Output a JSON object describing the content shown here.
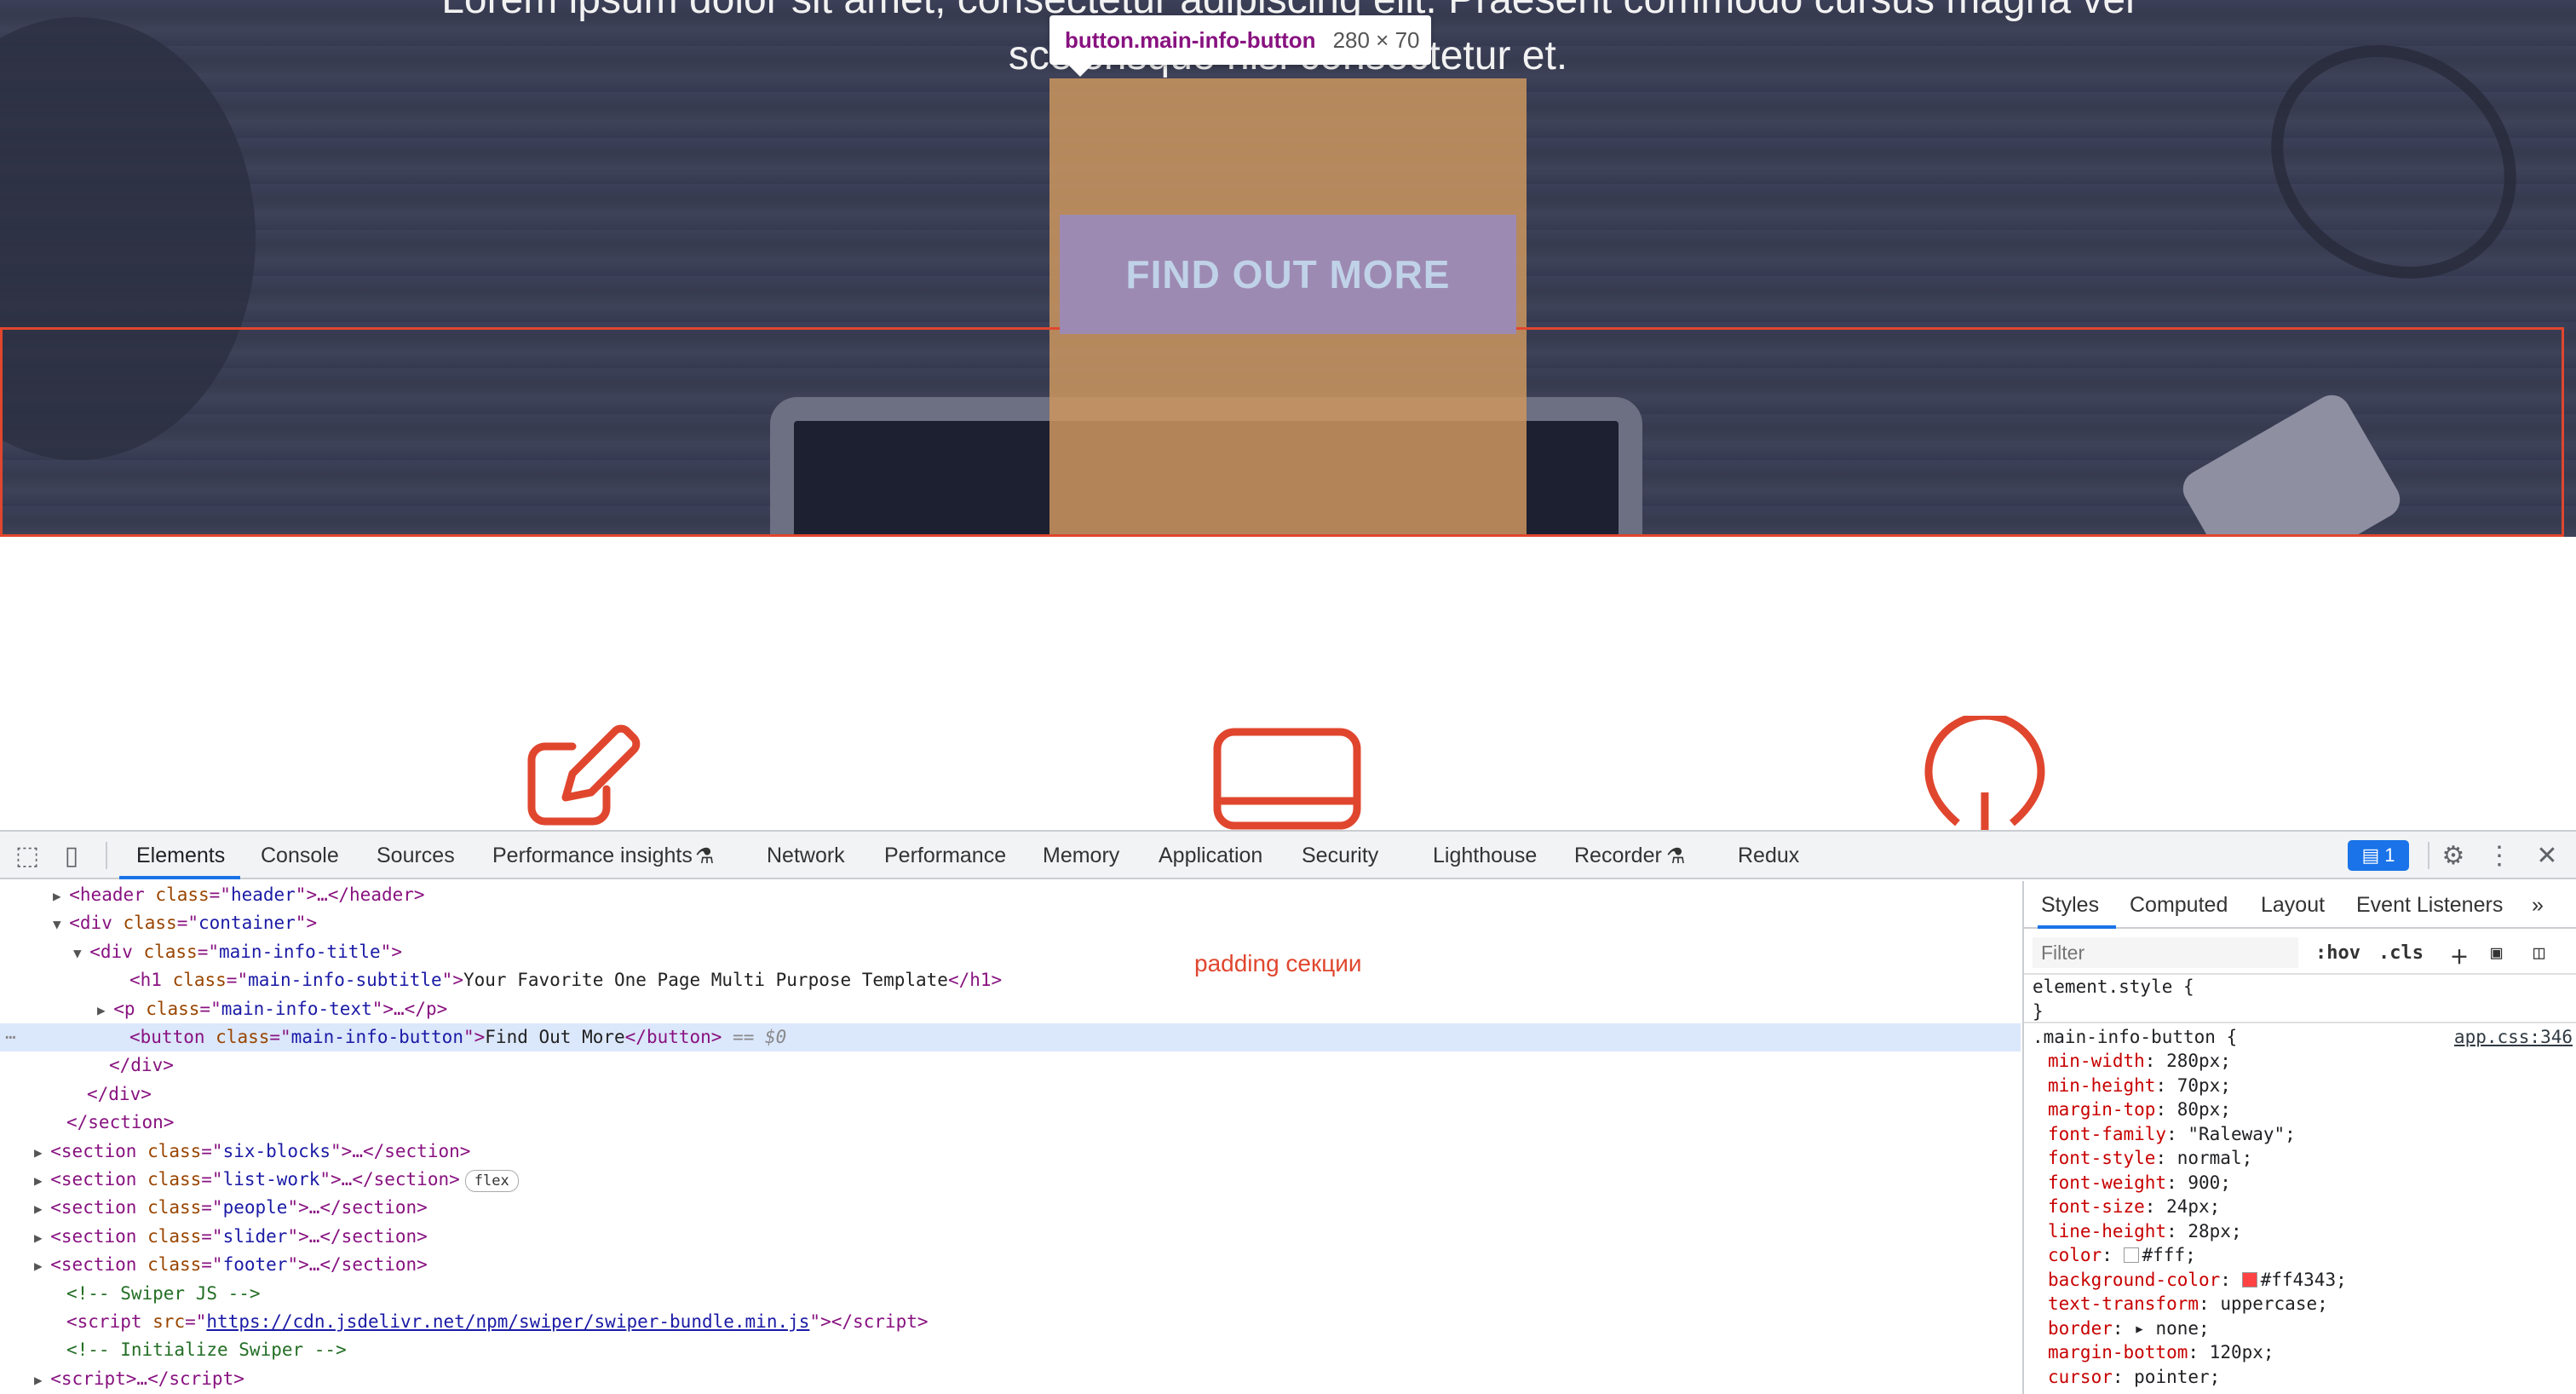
{
  "page": {
    "hero_line1": "Lorem ipsum dolor sit amet, consectetur adipiscing elit. Praesent commodo cursus magna vel",
    "hero_line2": "scelerisque nisl consectetur et.",
    "button_label": "FIND OUT MORE",
    "tooltip_selector": "button.main-info-button",
    "tooltip_size": "280 × 70",
    "annotation": "padding секции",
    "accent_color": "#e0462e"
  },
  "devtools": {
    "tabs": [
      "Elements",
      "Console",
      "Sources",
      "Performance insights",
      "Network",
      "Performance",
      "Memory",
      "Application",
      "Security",
      "Lighthouse",
      "Recorder",
      "Redux"
    ],
    "issues_count": "1",
    "elements_lines": [
      {
        "open": "<",
        "tag": "header",
        "attrs": [
          [
            "class",
            "header"
          ]
        ],
        "tail": ">…</",
        "endtag": "header",
        "end": ">"
      },
      {
        "open": "<",
        "tag": "div",
        "attrs": [
          [
            "class",
            "container"
          ]
        ],
        "tail": ">",
        "endtag": "",
        "end": ""
      },
      {
        "open": "<",
        "tag": "div",
        "attrs": [
          [
            "class",
            "main-info-title"
          ]
        ],
        "tail": ">",
        "endtag": "",
        "end": ""
      },
      {
        "open": "<",
        "tag": "h1",
        "attrs": [
          [
            "class",
            "main-info-subtitle"
          ]
        ],
        "tail": ">",
        "text": "Your Favorite One Page Multi Purpose Template",
        "endtag": "h1",
        "end": ">"
      },
      {
        "open": "<",
        "tag": "p",
        "attrs": [
          [
            "class",
            "main-info-text"
          ]
        ],
        "tail": ">…</",
        "endtag": "p",
        "end": ">"
      },
      {
        "open": "<",
        "tag": "button",
        "attrs": [
          [
            "class",
            "main-info-button"
          ]
        ],
        "tail": ">",
        "text": "Find Out More",
        "endtag": "button",
        "end": ">",
        "suffix": " == $0"
      },
      {
        "open": "</",
        "tag": "div",
        "attrs": [],
        "tail": ">",
        "endtag": "",
        "end": ""
      },
      {
        "open": "</",
        "tag": "div",
        "attrs": [],
        "tail": ">",
        "endtag": "",
        "end": ""
      },
      {
        "open": "</",
        "tag": "section",
        "attrs": [],
        "tail": ">",
        "endtag": "",
        "end": ""
      },
      {
        "open": "<",
        "tag": "section",
        "attrs": [
          [
            "class",
            "six-blocks"
          ]
        ],
        "tail": ">…</",
        "endtag": "section",
        "end": ">"
      },
      {
        "open": "<",
        "tag": "section",
        "attrs": [
          [
            "class",
            "list-work"
          ]
        ],
        "tail": ">…</",
        "endtag": "section",
        "end": ">",
        "badge": "flex"
      },
      {
        "open": "<",
        "tag": "section",
        "attrs": [
          [
            "class",
            "people"
          ]
        ],
        "tail": ">…</",
        "endtag": "section",
        "end": ">"
      },
      {
        "open": "<",
        "tag": "section",
        "attrs": [
          [
            "class",
            "slider"
          ]
        ],
        "tail": ">…</",
        "endtag": "section",
        "end": ">"
      },
      {
        "open": "<",
        "tag": "section",
        "attrs": [
          [
            "class",
            "footer"
          ]
        ],
        "tail": ">…</",
        "endtag": "section",
        "end": ">"
      },
      {
        "comment": "<!-- Swiper JS -->"
      },
      {
        "open": "<",
        "tag": "script",
        "attrs": [
          [
            "src",
            "https://cdn.jsdelivr.net/npm/swiper/swiper-bundle.min.js"
          ]
        ],
        "link": true,
        "tail": "></",
        "endtag": "script",
        "end": ">"
      },
      {
        "comment": "<!-- Initialize Swiper -->"
      },
      {
        "open": "<",
        "tag": "script",
        "attrs": [],
        "tail": ">…</",
        "endtag": "script",
        "end": ">"
      }
    ],
    "styles": {
      "tabs": [
        "Styles",
        "Computed",
        "Layout",
        "Event Listeners"
      ],
      "filter_placeholder": "Filter",
      "hov": ":hov",
      "cls": ".cls",
      "element_style": "element.style {",
      "element_close": "}",
      "rule_selector": ".main-info-button {",
      "rule_source": "app.css:346",
      "declarations": [
        {
          "prop": "min-width",
          "value": "280px;"
        },
        {
          "prop": "min-height",
          "value": "70px;"
        },
        {
          "prop": "margin-top",
          "value": "80px;"
        },
        {
          "prop": "font-family",
          "value": "\"Raleway\";"
        },
        {
          "prop": "font-style",
          "value": "normal;"
        },
        {
          "prop": "font-weight",
          "value": "900;"
        },
        {
          "prop": "font-size",
          "value": "24px;"
        },
        {
          "prop": "line-height",
          "value": "28px;"
        },
        {
          "prop": "color",
          "value": "#fff;",
          "swatch": "#ffffff"
        },
        {
          "prop": "background-color",
          "value": "#ff4343;",
          "swatch": "#ff4343"
        },
        {
          "prop": "text-transform",
          "value": "uppercase;"
        },
        {
          "prop": "border",
          "value": "none;",
          "arrow": true
        },
        {
          "prop": "margin-bottom",
          "value": "120px;"
        },
        {
          "prop": "cursor",
          "value": "pointer;"
        }
      ]
    }
  }
}
